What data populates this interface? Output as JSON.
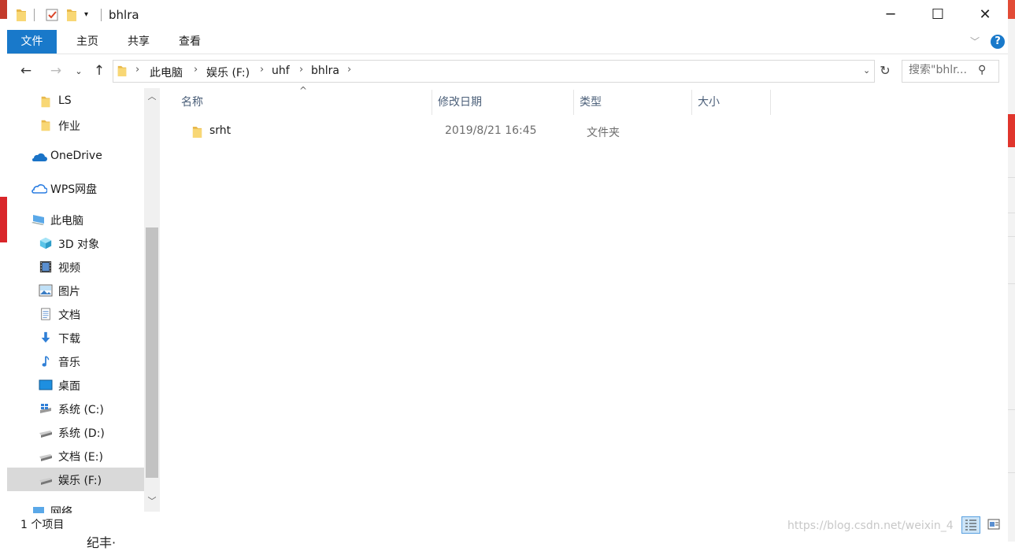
{
  "window": {
    "title": "bhlra",
    "controls": {
      "minimize": "─",
      "maximize": "☐",
      "close": "✕"
    }
  },
  "ribbon": {
    "tabs": [
      {
        "label": "文件",
        "active": true
      },
      {
        "label": "主页"
      },
      {
        "label": "共享"
      },
      {
        "label": "查看"
      }
    ],
    "help_label": "?"
  },
  "address": {
    "crumbs": [
      "此电脑",
      "娱乐 (F:)",
      "uhf",
      "bhlra"
    ]
  },
  "search": {
    "placeholder": "搜索\"bhlr..."
  },
  "nav": {
    "items": [
      {
        "label": "LS",
        "icon": "folder-icon"
      },
      {
        "label": "作业",
        "icon": "folder-icon"
      },
      {
        "label": "OneDrive",
        "icon": "onedrive-icon"
      },
      {
        "label": "WPS网盘",
        "icon": "wps-cloud-icon"
      },
      {
        "label": "此电脑",
        "icon": "this-pc-icon"
      },
      {
        "label": "3D 对象",
        "icon": "3d-objects-icon"
      },
      {
        "label": "视频",
        "icon": "video-icon"
      },
      {
        "label": "图片",
        "icon": "pictures-icon"
      },
      {
        "label": "文档",
        "icon": "documents-icon"
      },
      {
        "label": "下载",
        "icon": "download-icon"
      },
      {
        "label": "音乐",
        "icon": "music-icon"
      },
      {
        "label": "桌面",
        "icon": "desktop-icon"
      },
      {
        "label": "系统 (C:)",
        "icon": "system-drive-icon"
      },
      {
        "label": "系统 (D:)",
        "icon": "drive-icon"
      },
      {
        "label": "文档 (E:)",
        "icon": "drive-icon"
      },
      {
        "label": "娱乐 (F:)",
        "icon": "drive-icon",
        "selected": true
      },
      {
        "label": "网络",
        "icon": "network-icon"
      }
    ]
  },
  "columns": {
    "name": "名称",
    "modified": "修改日期",
    "type": "类型",
    "size": "大小"
  },
  "files": [
    {
      "name": "srht",
      "modified": "2019/8/21 16:45",
      "type": "文件夹",
      "size": ""
    }
  ],
  "status": {
    "count_text": "1 个项目"
  },
  "watermark": "https://blog.csdn.net/weixin_4",
  "below_text": "纪丰·",
  "background_colors": {
    "accent": "#1979ca",
    "folder": "#f8d775",
    "selected": "#d9d9d9"
  }
}
